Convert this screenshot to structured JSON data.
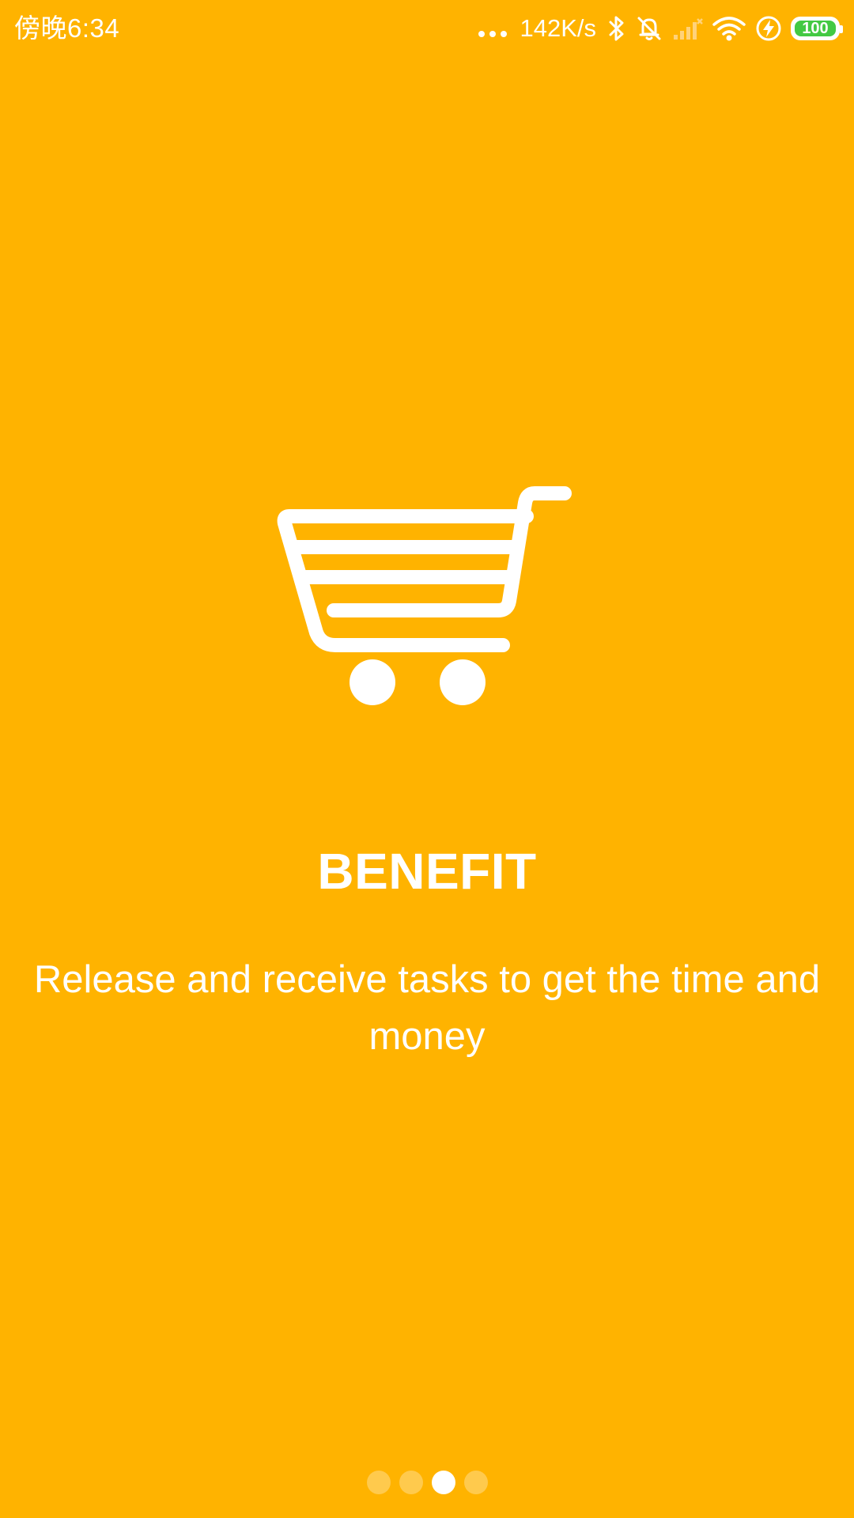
{
  "status_bar": {
    "time": "傍晚6:34",
    "net_speed": "142K/s",
    "battery_level": "100",
    "icons": [
      "more-dots-icon",
      "bluetooth-icon",
      "mute-bell-icon",
      "cellular-signal-icon",
      "wifi-icon",
      "charging-icon",
      "battery-icon"
    ]
  },
  "onboarding": {
    "illustration": "shopping-cart-icon",
    "title": "BENEFIT",
    "description": "Release and receive tasks to get the time and money",
    "pages_total": 4,
    "current_page": 3
  },
  "colors": {
    "background": "#FFB300",
    "foreground": "#FFFFFF",
    "battery_fill": "#43C943"
  }
}
